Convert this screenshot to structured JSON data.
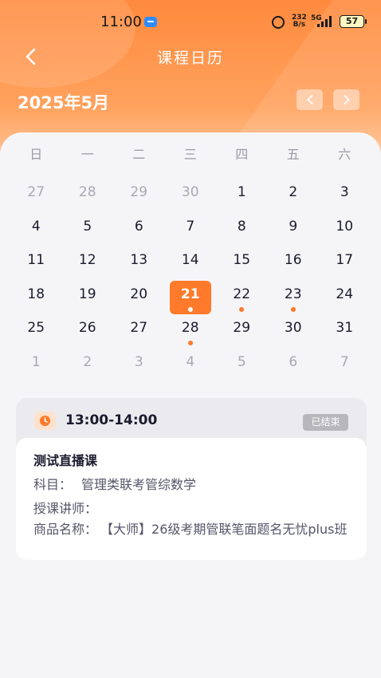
{
  "status_bar": {
    "time": "11:00",
    "net_speed_top": "232",
    "net_speed_bottom": "B/s",
    "signal_label": "5G",
    "battery": "57"
  },
  "header": {
    "title": "课程日历",
    "month": "2025年5月"
  },
  "calendar": {
    "weekdays": [
      "日",
      "一",
      "二",
      "三",
      "四",
      "五",
      "六"
    ],
    "weeks": [
      [
        "27",
        "28",
        "29",
        "30",
        "1",
        "2",
        "3"
      ],
      [
        "4",
        "5",
        "6",
        "7",
        "8",
        "9",
        "10"
      ],
      [
        "11",
        "12",
        "13",
        "14",
        "15",
        "16",
        "17"
      ],
      [
        "18",
        "19",
        "20",
        "21",
        "22",
        "23",
        "24"
      ],
      [
        "25",
        "26",
        "27",
        "28",
        "29",
        "30",
        "31"
      ],
      [
        "1",
        "2",
        "3",
        "4",
        "5",
        "6",
        "7"
      ]
    ],
    "selected_day": "21",
    "days_with_courses": [
      "21",
      "22",
      "23",
      "28"
    ]
  },
  "course": {
    "time": "13:00-14:00",
    "status": "已结束",
    "name": "测试直播课",
    "subject_label": "科目：",
    "subject_value": "管理类联考管综数学",
    "teacher_label": "授课讲师：",
    "teacher_value": "",
    "product_label": "商品名称：",
    "product_value": "【大师】26级考期管联笔面题名无忧plus班"
  },
  "colors": {
    "accent": "#ff7a2a",
    "header_gradient_top": "#ff8a3d",
    "badge_gray": "#b7b7bd"
  }
}
